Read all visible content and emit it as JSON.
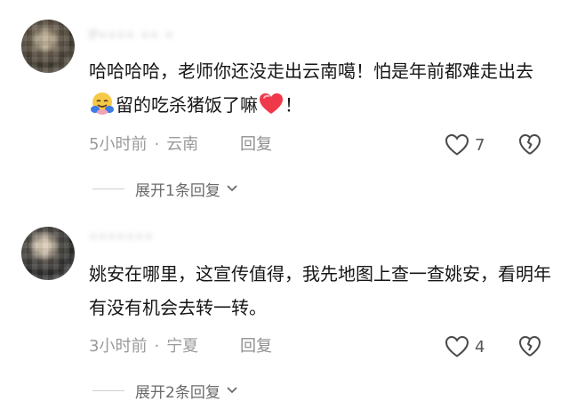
{
  "comments": [
    {
      "username": "P•••• •• •",
      "text_part1": "哈哈哈哈，老师你还没走出云南噶！怕是年前都难走出去",
      "text_part2": "留的吃杀猪饭了嘛",
      "text_part3": "！",
      "time": "5小时前",
      "location": "云南",
      "reply_label": "回复",
      "like_count": "7",
      "expand_label": "展开1条回复"
    },
    {
      "username": "•••••••",
      "text": "姚安在哪里，这宣传值得，我先地图上查一查姚安，看明年有没有机会去转一转。",
      "time": "3小时前",
      "location": "宁夏",
      "reply_label": "回复",
      "like_count": "4",
      "expand_label": "展开2条回复"
    }
  ],
  "icons": {
    "like": "heart-outline-icon",
    "dislike": "broken-heart-outline-icon",
    "expand": "chevron-down-icon",
    "emoji_hug": "hugging-face-emoji",
    "emoji_heart": "red-heart-emoji"
  }
}
